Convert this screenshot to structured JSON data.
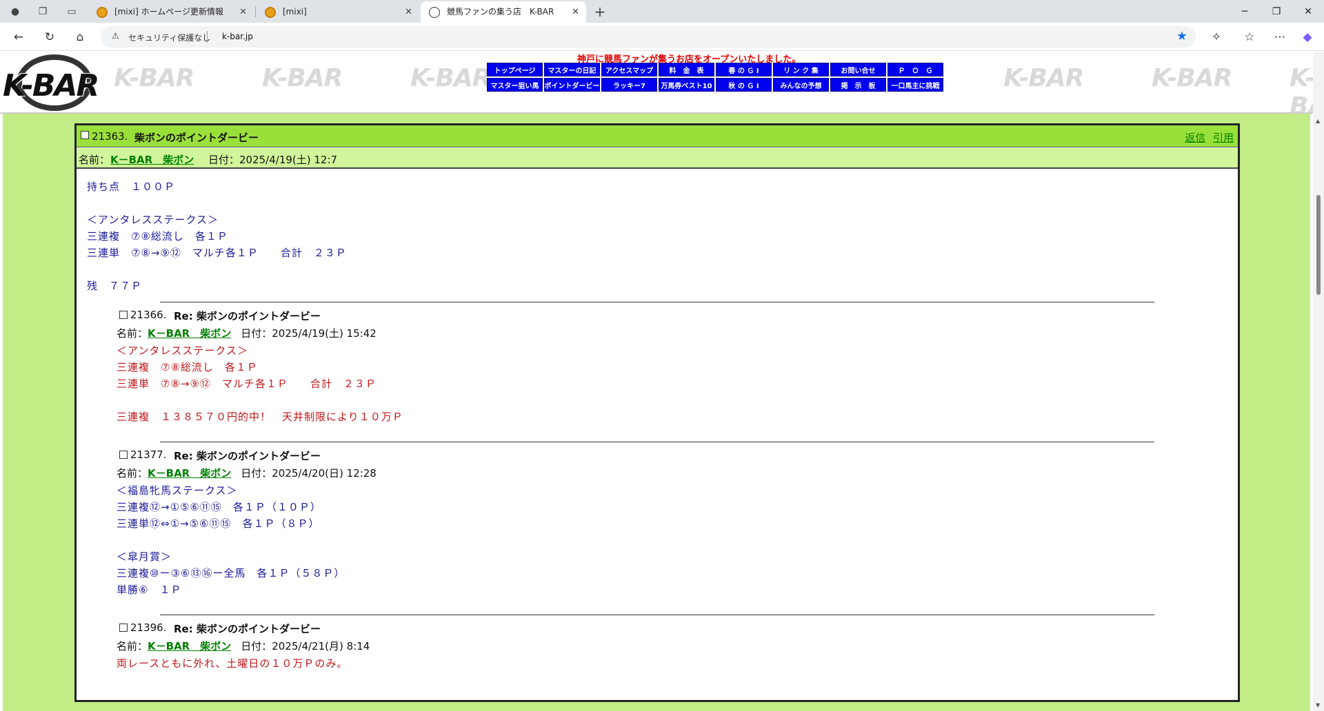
{
  "browser": {
    "tabs": [
      {
        "label": "[mixi] ホームページ更新情報"
      },
      {
        "label": "[mixi]"
      },
      {
        "label": "競馬ファンの集う店　K-BAR"
      }
    ],
    "security_text": "セキュリティ保護なし",
    "url": "k-bar.jp"
  },
  "site": {
    "logo_text": "K-BAR",
    "watermark_text": "K-BAR",
    "banner": "神戸に競馬ファンが集うお店をオープンいたしました。",
    "nav": [
      "トップページ",
      "マスターの日記",
      "アクセスマップ",
      "料　金　表",
      "春 の Ｇ Ⅰ",
      "リ ン ク 集",
      "お問い合せ",
      "Ｐ　Ｏ　Ｇ",
      "マスター狙い馬",
      "ポイントダービー",
      "ラッキー7",
      "万馬券ベスト10",
      "秋 の Ｇ Ⅰ",
      "みんなの予想",
      "掲　示　板",
      "一口馬主に挑戦"
    ]
  },
  "post": {
    "number": "21363.",
    "title": "柴ボンのポイントダービー",
    "reply_link": "返信",
    "quote_link": "引用",
    "name_label": "名前：",
    "author": "K－BAR　柴ボン",
    "date": "日付：2025/4/19(土) 12:7",
    "body": [
      "持ち点　１００Ｐ",
      "",
      "＜アンタレスステークス＞",
      "三連複　⑦⑧総流し　各１Ｐ",
      "三連単　⑦⑧→⑨⑫　マルチ各１Ｐ　　合計　２３Ｐ",
      "",
      "残　７７Ｐ"
    ]
  },
  "replies": [
    {
      "number": "21366.",
      "title": "Re: 柴ボンのポイントダービー",
      "name_label": "名前：",
      "author": "K－BAR　柴ボン",
      "date": "日付：2025/4/19(土) 15:42",
      "body": "＜アンタレスステークス＞\n三連複　⑦⑧総流し　各１Ｐ\n三連単　⑦⑧→⑨⑫　マルチ各１Ｐ　　合計　２３Ｐ\n\n三連複　１３８５７０円的中！　天井制限により１０万Ｐ"
    },
    {
      "number": "21377.",
      "title": "Re: 柴ボンのポイントダービー",
      "name_label": "名前：",
      "author": "K－BAR　柴ボン",
      "date": "日付：2025/4/20(日) 12:28",
      "body": "＜福島牝馬ステークス＞\n三連複⑫→①⑤⑥⑪⑮　各１Ｐ（１０Ｐ）\n三連単⑫⇔①→⑤⑥⑪⑮　各１Ｐ（８Ｐ）\n\n＜皐月賞＞\n三連複⑩ー③⑥⑬⑯ー全馬　各１Ｐ（５８Ｐ）\n単勝⑥　１Ｐ"
    },
    {
      "number": "21396.",
      "title": "Re: 柴ボンのポイントダービー",
      "name_label": "名前：",
      "author": "K－BAR　柴ボン",
      "date": "日付：2025/4/21(月) 8:14",
      "body": "両レースともに外れ、土曜日の１０万Ｐのみ。"
    }
  ]
}
